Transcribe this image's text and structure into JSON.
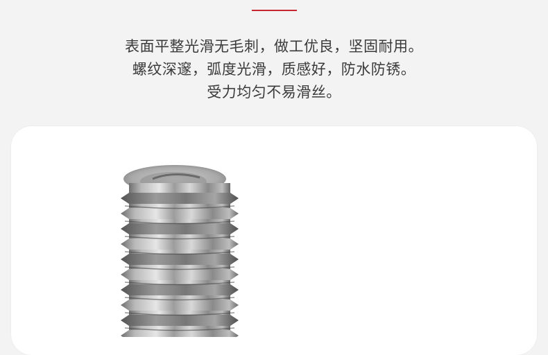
{
  "description": {
    "lines": [
      "表面平整光滑无毛刺，做工优良，坚固耐用。",
      "螺纹深邃，弧度光滑，质感好，防水防锈。",
      "受力均匀不易滑丝。"
    ]
  },
  "colors": {
    "accent": "#c8262f",
    "background": "#f3f3f3",
    "card": "#ffffff",
    "text": "#3a3a3a"
  },
  "image": {
    "subject": "stainless-steel-threaded-insert"
  }
}
